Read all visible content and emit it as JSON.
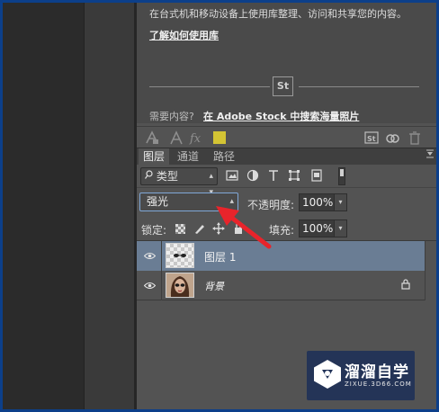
{
  "library": {
    "description": "在台式机和移动设备上使用库整理、访问和共享您的内容。",
    "learn_link": "了解如何使用库",
    "stock_badge": "St",
    "need_content_label": "需要内容?",
    "stock_link": "在 Adobe Stock 中搜索海量照片",
    "swatch_color": "#d3c434"
  },
  "layers_panel": {
    "tabs": [
      {
        "label": "图层",
        "active": true
      },
      {
        "label": "通道",
        "active": false
      },
      {
        "label": "路径",
        "active": false
      }
    ],
    "kind_filter": "类型",
    "blend_mode": "强光",
    "opacity_label": "不透明度:",
    "opacity_value": "100%",
    "lock_label": "锁定:",
    "fill_label": "填充:",
    "fill_value": "100%",
    "layers": [
      {
        "name": "图层 1",
        "selected": true,
        "visible": true
      },
      {
        "name": "背景",
        "selected": false,
        "visible": true,
        "locked": true
      }
    ]
  },
  "watermark": {
    "title": "溜溜自学",
    "subtitle": "ZIXUE.3D66.COM"
  },
  "colors": {
    "panel_bg": "#535353",
    "selected_layer": "#6a7d94",
    "arrow": "#e8242b",
    "frame": "#0c3f8a"
  }
}
